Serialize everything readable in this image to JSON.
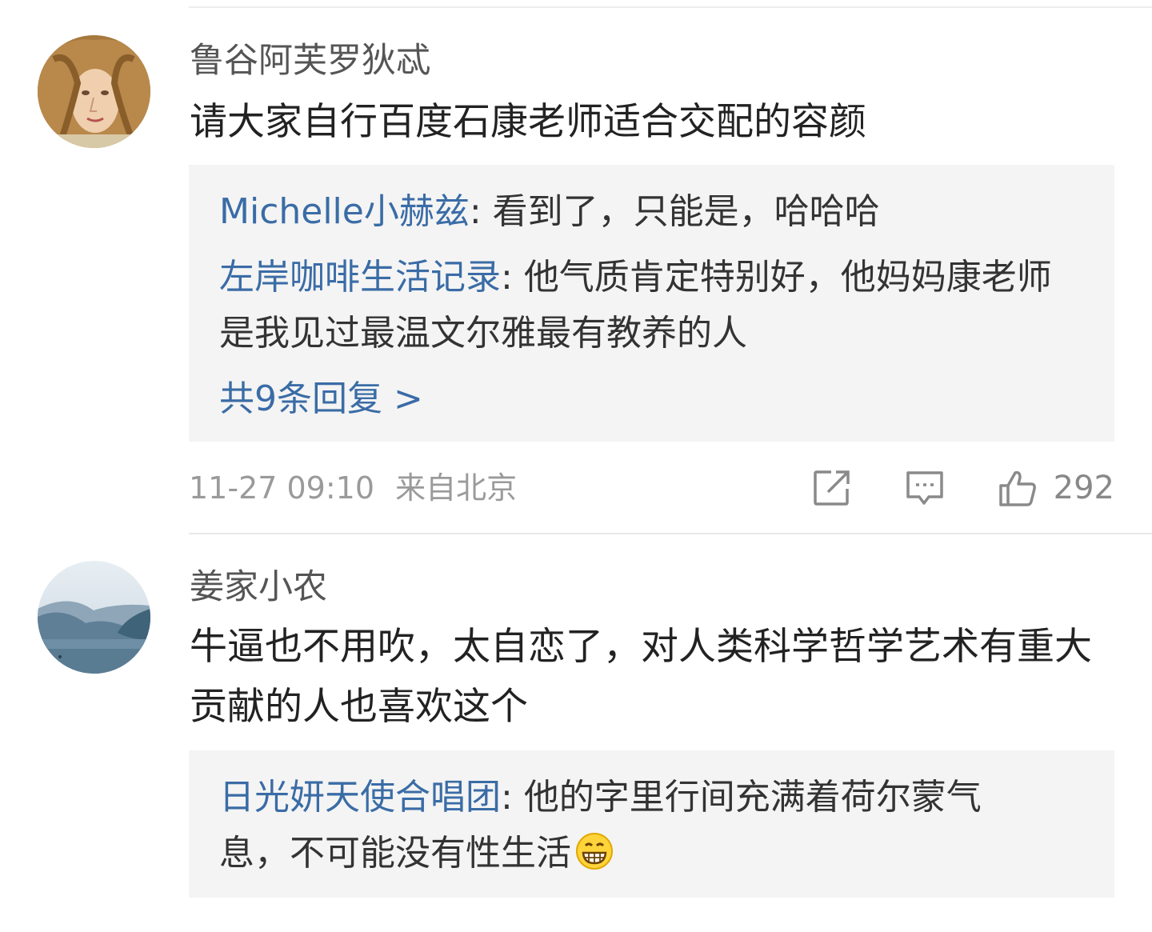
{
  "comments": [
    {
      "username": "鲁谷阿芙罗狄忒",
      "text": "请大家自行百度石康老师适合交配的容颜",
      "replies": [
        {
          "user": "Michelle小赫兹",
          "sep": ": ",
          "text": "看到了，只能是，哈哈哈"
        },
        {
          "user": "左岸咖啡生活记录",
          "sep": ": ",
          "text": "他气质肯定特别好，他妈妈康老师是我见过最温文尔雅最有教养的人"
        }
      ],
      "reply_count_label": "共9条回复 >",
      "time": "11-27 09:10",
      "location": "来自北京",
      "likes": "292",
      "icons": [
        "share-icon",
        "comment-icon",
        "like-icon"
      ]
    },
    {
      "username": "姜家小农",
      "text": "牛逼也不用吹，太自恋了，对人类科学哲学艺术有重大贡献的人也喜欢这个",
      "replies": [
        {
          "user": "日光妍天使合唱团",
          "sep": ": ",
          "text": "他的字里行间充满着荷尔蒙气息，不可能没有性生活"
        }
      ],
      "emoji": "grin-emoji"
    }
  ],
  "colors": {
    "reply_user": "#3a6ca6",
    "reply_bg": "#f4f4f4",
    "meta": "#9a9a9a"
  }
}
